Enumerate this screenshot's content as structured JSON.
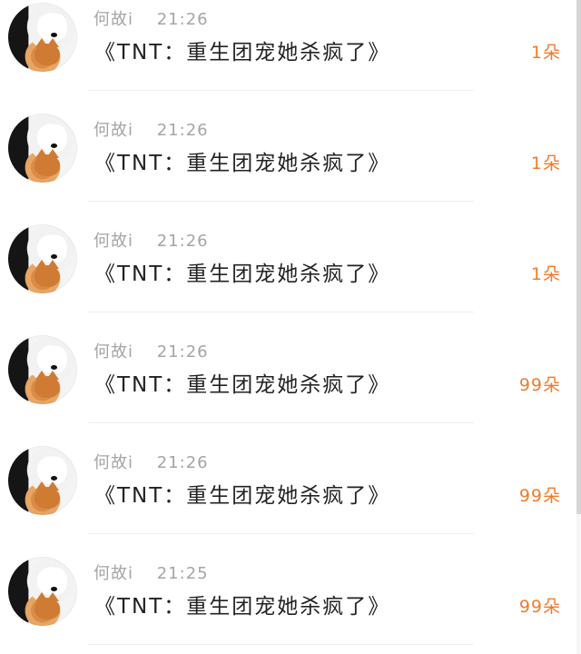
{
  "messages": [
    {
      "sender": "何故i",
      "time": "21:26",
      "title": "《TNT：重生团宠她杀疯了》",
      "gift_count": "1朵"
    },
    {
      "sender": "何故i",
      "time": "21:26",
      "title": "《TNT：重生团宠她杀疯了》",
      "gift_count": "1朵"
    },
    {
      "sender": "何故i",
      "time": "21:26",
      "title": "《TNT：重生团宠她杀疯了》",
      "gift_count": "1朵"
    },
    {
      "sender": "何故i",
      "time": "21:26",
      "title": "《TNT：重生团宠她杀疯了》",
      "gift_count": "99朵"
    },
    {
      "sender": "何故i",
      "time": "21:26",
      "title": "《TNT：重生团宠她杀疯了》",
      "gift_count": "99朵"
    },
    {
      "sender": "何故i",
      "time": "21:25",
      "title": "《TNT：重生团宠她杀疯了》",
      "gift_count": "99朵"
    }
  ],
  "colors": {
    "background": "#ffffff",
    "meta_text": "#a5a5a5",
    "title_text": "#222222",
    "gift_count": "#f17b2c",
    "divider": "#eeeeee"
  },
  "icons": {
    "avatar": "dog-and-cat-avatar-icon"
  }
}
